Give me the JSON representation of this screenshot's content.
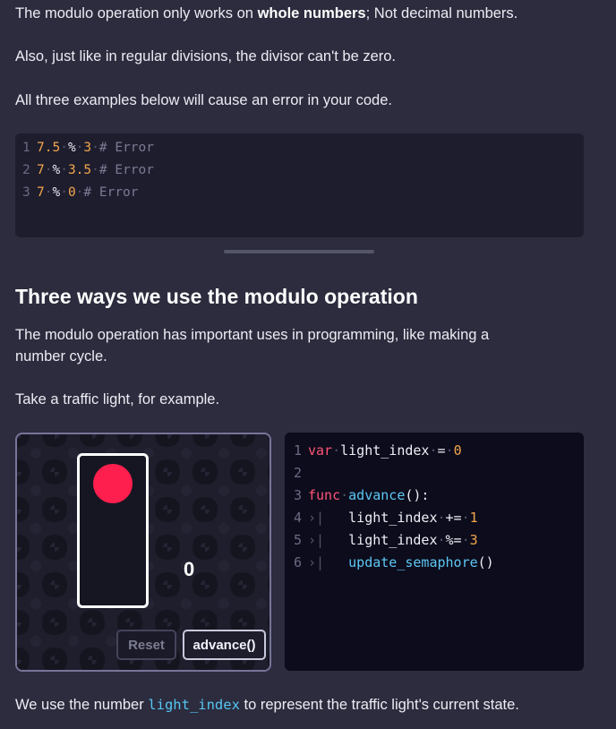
{
  "paragraphs": {
    "p1_pre": "The modulo operation only works on ",
    "p1_bold": "whole numbers",
    "p1_post": "; Not decimal numbers.",
    "p2": "Also, just like in regular divisions, the divisor can't be zero.",
    "p3": "All three examples below will cause an error in your code."
  },
  "code1": {
    "lines": [
      {
        "n": "1",
        "a": "7.5",
        "op": "%",
        "b": "3",
        "comment": "# Error"
      },
      {
        "n": "2",
        "a": "7",
        "op": "%",
        "b": "3.5",
        "comment": "# Error"
      },
      {
        "n": "3",
        "a": "7",
        "op": "%",
        "b": "0",
        "comment": "# Error"
      }
    ]
  },
  "section": {
    "heading": "Three ways we use the modulo operation",
    "p4_line1": "The modulo operation has important uses in programming, like making a",
    "p4_line2": "number cycle.",
    "p5": "Take a traffic light, for example."
  },
  "demo": {
    "counter": "0",
    "reset_label": "Reset",
    "advance_label": "advance()",
    "light_color": "#ff1f4e"
  },
  "code2": {
    "n1": "1",
    "n2": "2",
    "n3": "3",
    "n4": "4",
    "n5": "5",
    "n6": "6",
    "var_kw": "var",
    "var_name": "light_index",
    "assign": "=",
    "zero": "0",
    "func_kw": "func",
    "func_name": "advance",
    "func_sig": "():",
    "l4_name": "light_index",
    "l4_op": "+=",
    "l4_val": "1",
    "l5_name": "light_index",
    "l5_op": "%=",
    "l5_val": "3",
    "l6_call": "update_semaphore",
    "l6_parens": "()"
  },
  "footer": {
    "pre": "We use the number ",
    "code": "light_index",
    "post": " to represent the traffic light's current state."
  }
}
